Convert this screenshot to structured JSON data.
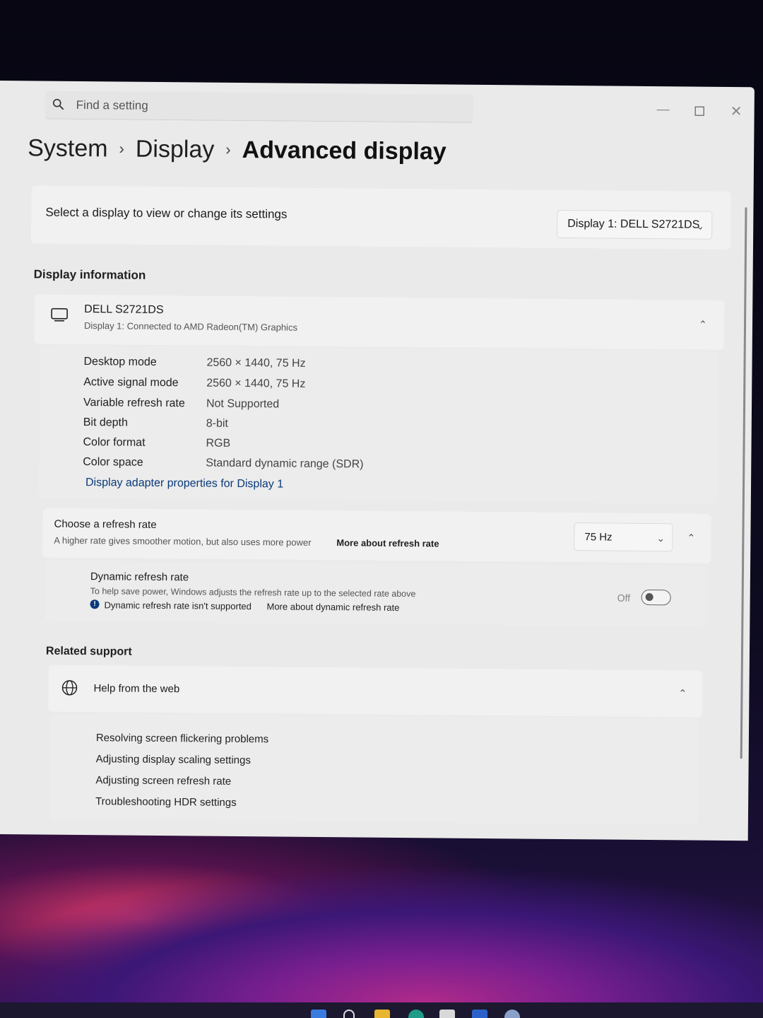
{
  "search": {
    "placeholder": "Find a setting"
  },
  "breadcrumb": {
    "level1": "System",
    "level2": "Display",
    "current": "Advanced display",
    "separator": "›"
  },
  "select_display": {
    "label": "Select a display to view or change its settings",
    "selected": "Display 1: DELL S2721DS"
  },
  "display_information": {
    "title": "Display information",
    "monitor_name": "DELL S2721DS",
    "monitor_subtitle": "Display 1: Connected to AMD Radeon(TM) Graphics",
    "rows": [
      {
        "label": "Desktop mode",
        "value": "2560 × 1440, 75 Hz"
      },
      {
        "label": "Active signal mode",
        "value": "2560 × 1440, 75 Hz"
      },
      {
        "label": "Variable refresh rate",
        "value": "Not Supported"
      },
      {
        "label": "Bit depth",
        "value": "8-bit"
      },
      {
        "label": "Color format",
        "value": "RGB"
      },
      {
        "label": "Color space",
        "value": "Standard dynamic range (SDR)"
      }
    ],
    "adapter_link": "Display adapter properties for Display 1"
  },
  "refresh_rate": {
    "title": "Choose a refresh rate",
    "subtitle": "A higher rate gives smoother motion, but also uses more power",
    "more_link": "More about refresh rate",
    "selected": "75 Hz"
  },
  "dynamic_refresh": {
    "title": "Dynamic refresh rate",
    "description": "To help save power, Windows adjusts the refresh rate up to the selected rate above",
    "notice": "Dynamic refresh rate isn't supported",
    "more_link": "More about dynamic refresh rate",
    "toggle_label": "Off",
    "toggle_on": false
  },
  "related_support": {
    "title": "Related support",
    "help_title": "Help from the web",
    "links": [
      "Resolving screen flickering problems",
      "Adjusting display scaling settings",
      "Adjusting screen refresh rate",
      "Troubleshooting HDR settings"
    ]
  },
  "icons": {
    "search": "search-icon",
    "minimize": "minimize-icon",
    "maximize": "maximize-icon",
    "close": "close-icon",
    "monitor": "monitor-icon",
    "globe": "globe-icon",
    "info": "info-icon"
  }
}
